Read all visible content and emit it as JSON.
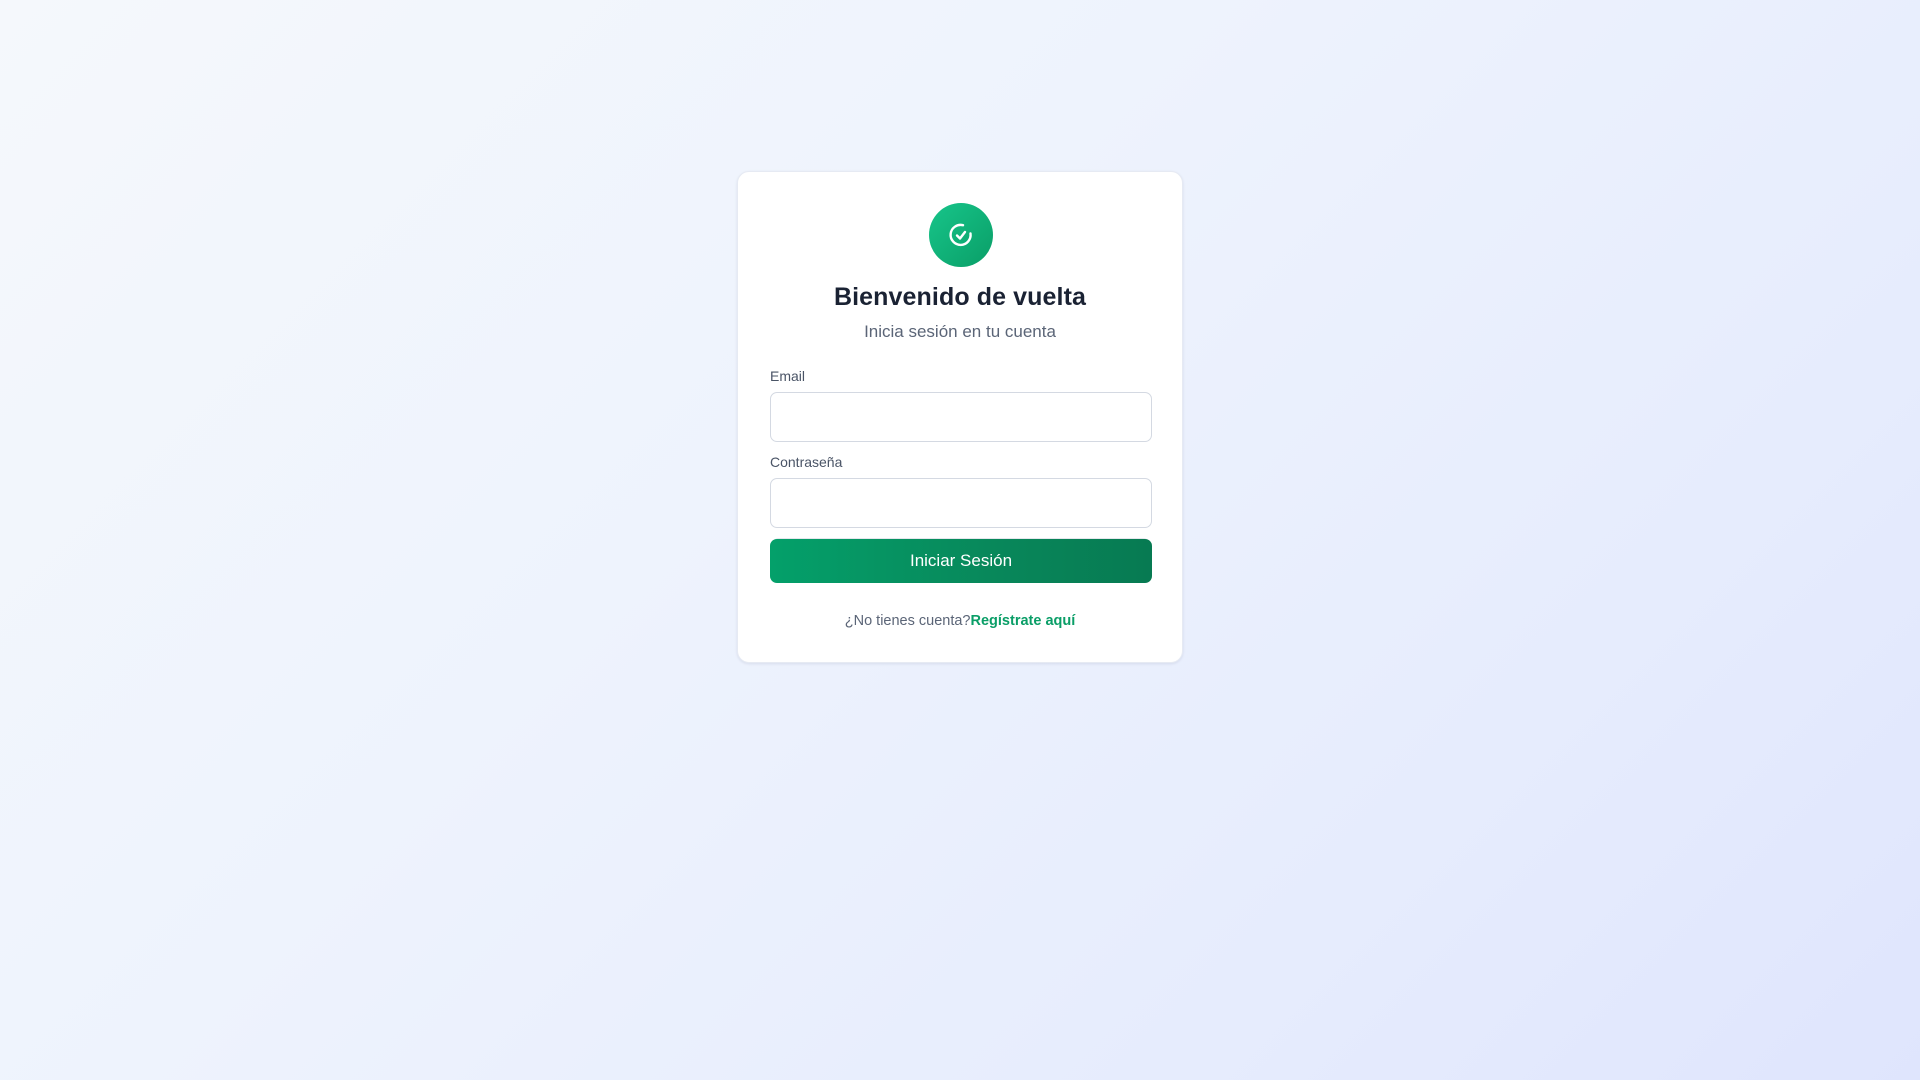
{
  "colors": {
    "accent": "#0a9e67",
    "accent_light": "#17c58a",
    "title": "#1a2233",
    "muted": "#5b6577"
  },
  "logo": {
    "icon": "check-circle-icon"
  },
  "login": {
    "title": "Bienvenido de vuelta",
    "subtitle": "Inicia sesión en tu cuenta",
    "email_label": "Email",
    "email_value": "",
    "password_label": "Contraseña",
    "password_value": "",
    "submit_label": "Iniciar Sesión",
    "signup_prompt": "¿No tienes cuenta?",
    "signup_link": "Regístrate aquí"
  }
}
